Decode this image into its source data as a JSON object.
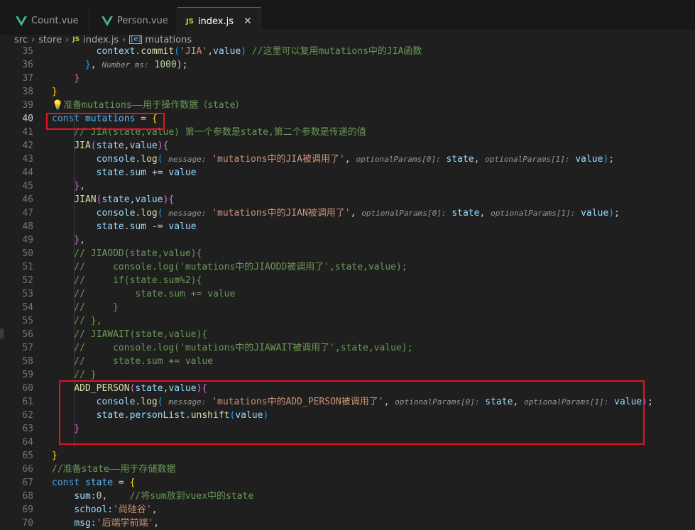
{
  "tabs": [
    {
      "label": "Count.vue",
      "icon": "vue-icon",
      "active": false
    },
    {
      "label": "Person.vue",
      "icon": "vue-icon",
      "active": false
    },
    {
      "label": "index.js",
      "icon": "js-icon",
      "active": true
    }
  ],
  "tab_icons": {
    "js": "JS",
    "close": "✕"
  },
  "breadcrumb": {
    "parts": [
      "src",
      "store",
      "index.js",
      "mutations"
    ],
    "separator": "›",
    "js_badge": "JS",
    "symbol_badge": "[e]"
  },
  "colors": {
    "accent": "#0078d4",
    "highlight_box": "#e81123",
    "keyword": "#569cd6",
    "string": "#ce9178",
    "comment": "#6a9955",
    "function": "#dcdcaa",
    "variable": "#9cdcfe",
    "number": "#b5cea8",
    "bracket_gold": "#ffd700",
    "bracket_purple": "#da70d6",
    "bracket_blue": "#179fff"
  },
  "lines": [
    {
      "n": "35",
      "segs": [
        [
          "        ",
          "#cccccc"
        ],
        [
          "context",
          "#9cdcfe"
        ],
        [
          ".",
          "#cccccc"
        ],
        [
          "commit",
          "#dcdcaa"
        ],
        [
          "(",
          "#179fff"
        ],
        [
          "'JIA'",
          "#ce9178"
        ],
        [
          ",",
          "#cccccc"
        ],
        [
          "value",
          "#9cdcfe"
        ],
        [
          ")",
          "#179fff"
        ],
        [
          " //这里可以复用mutations中的JIA函数",
          "#6a9955"
        ]
      ]
    },
    {
      "n": "36",
      "segs": [
        [
          "      ",
          "#cccccc"
        ],
        [
          "}",
          "#179fff"
        ],
        [
          ", ",
          "#cccccc"
        ],
        [
          "Number ms:",
          "hint"
        ],
        [
          " ",
          "#cccccc"
        ],
        [
          "1000",
          "#b5cea8"
        ],
        [
          ");",
          "#cccccc"
        ]
      ]
    },
    {
      "n": "37",
      "segs": [
        [
          "    ",
          "#cccccc"
        ],
        [
          "}",
          "#da70d6"
        ]
      ]
    },
    {
      "n": "38",
      "segs": [
        [
          "}",
          "#ffd700"
        ]
      ]
    },
    {
      "n": "39",
      "segs": [
        [
          "💡",
          "bulb"
        ],
        [
          "准备mutations——用于操作数据（state）",
          "#6a9955"
        ]
      ]
    },
    {
      "n": "40",
      "segs": [
        [
          "const",
          "#569cd6"
        ],
        [
          " ",
          "#cccccc"
        ],
        [
          "mutations",
          "#4fc1ff"
        ],
        [
          " = ",
          "#cccccc"
        ],
        [
          "{",
          "#ffd700"
        ]
      ],
      "current": true
    },
    {
      "n": "41",
      "segs": [
        [
          "    // JIA(state,value) 第一个参数是state,第二个参数是传递的值",
          "#6a9955"
        ]
      ]
    },
    {
      "n": "42",
      "segs": [
        [
          "    ",
          "#cccccc"
        ],
        [
          "JIA",
          "#dcdcaa"
        ],
        [
          "(",
          "#da70d6"
        ],
        [
          "state",
          "#9cdcfe"
        ],
        [
          ",",
          "#cccccc"
        ],
        [
          "value",
          "#9cdcfe"
        ],
        [
          ")",
          "#da70d6"
        ],
        [
          "{",
          "#da70d6"
        ]
      ]
    },
    {
      "n": "43",
      "segs": [
        [
          "        ",
          "#cccccc"
        ],
        [
          "console",
          "#9cdcfe"
        ],
        [
          ".",
          "#cccccc"
        ],
        [
          "log",
          "#dcdcaa"
        ],
        [
          "( ",
          "#179fff"
        ],
        [
          "message:",
          "hint"
        ],
        [
          " ",
          "#cccccc"
        ],
        [
          "'mutations中的JIA被调用了'",
          "#ce9178"
        ],
        [
          ", ",
          "#cccccc"
        ],
        [
          "optionalParams[0]:",
          "hint"
        ],
        [
          " ",
          "#cccccc"
        ],
        [
          "state",
          "#9cdcfe"
        ],
        [
          ", ",
          "#cccccc"
        ],
        [
          "optionalParams[1]:",
          "hint"
        ],
        [
          " ",
          "#cccccc"
        ],
        [
          "value",
          "#9cdcfe"
        ],
        [
          ")",
          "#179fff"
        ],
        [
          ";",
          "#cccccc"
        ]
      ]
    },
    {
      "n": "44",
      "segs": [
        [
          "        ",
          "#cccccc"
        ],
        [
          "state",
          "#9cdcfe"
        ],
        [
          ".",
          "#cccccc"
        ],
        [
          "sum",
          "#9cdcfe"
        ],
        [
          " += ",
          "#cccccc"
        ],
        [
          "value",
          "#9cdcfe"
        ]
      ]
    },
    {
      "n": "45",
      "segs": [
        [
          "    ",
          "#cccccc"
        ],
        [
          "}",
          "#da70d6"
        ],
        [
          ",",
          "#cccccc"
        ]
      ]
    },
    {
      "n": "46",
      "segs": [
        [
          "    ",
          "#cccccc"
        ],
        [
          "JIAN",
          "#dcdcaa"
        ],
        [
          "(",
          "#da70d6"
        ],
        [
          "state",
          "#9cdcfe"
        ],
        [
          ",",
          "#cccccc"
        ],
        [
          "value",
          "#9cdcfe"
        ],
        [
          ")",
          "#da70d6"
        ],
        [
          "{",
          "#da70d6"
        ]
      ]
    },
    {
      "n": "47",
      "segs": [
        [
          "        ",
          "#cccccc"
        ],
        [
          "console",
          "#9cdcfe"
        ],
        [
          ".",
          "#cccccc"
        ],
        [
          "log",
          "#dcdcaa"
        ],
        [
          "( ",
          "#179fff"
        ],
        [
          "message:",
          "hint"
        ],
        [
          " ",
          "#cccccc"
        ],
        [
          "'mutations中的JIAN被调用了'",
          "#ce9178"
        ],
        [
          ", ",
          "#cccccc"
        ],
        [
          "optionalParams[0]:",
          "hint"
        ],
        [
          " ",
          "#cccccc"
        ],
        [
          "state",
          "#9cdcfe"
        ],
        [
          ", ",
          "#cccccc"
        ],
        [
          "optionalParams[1]:",
          "hint"
        ],
        [
          " ",
          "#cccccc"
        ],
        [
          "value",
          "#9cdcfe"
        ],
        [
          ")",
          "#179fff"
        ],
        [
          ";",
          "#cccccc"
        ]
      ]
    },
    {
      "n": "48",
      "segs": [
        [
          "        ",
          "#cccccc"
        ],
        [
          "state",
          "#9cdcfe"
        ],
        [
          ".",
          "#cccccc"
        ],
        [
          "sum",
          "#9cdcfe"
        ],
        [
          " -= ",
          "#cccccc"
        ],
        [
          "value",
          "#9cdcfe"
        ]
      ]
    },
    {
      "n": "49",
      "segs": [
        [
          "    ",
          "#cccccc"
        ],
        [
          "}",
          "#da70d6"
        ],
        [
          ",",
          "#cccccc"
        ]
      ]
    },
    {
      "n": "50",
      "segs": [
        [
          "    // JIAODD(state,value){",
          "#6a9955"
        ]
      ]
    },
    {
      "n": "51",
      "segs": [
        [
          "    //     console.log('mutations中的JIAODD被调用了',state,value);",
          "#6a9955"
        ]
      ]
    },
    {
      "n": "52",
      "segs": [
        [
          "    //     if(state.sum%2){",
          "#6a9955"
        ]
      ]
    },
    {
      "n": "53",
      "segs": [
        [
          "    //         state.sum += value",
          "#6a9955"
        ]
      ]
    },
    {
      "n": "54",
      "segs": [
        [
          "    //     }",
          "#6a9955"
        ]
      ]
    },
    {
      "n": "55",
      "segs": [
        [
          "    // },",
          "#6a9955"
        ]
      ]
    },
    {
      "n": "56",
      "segs": [
        [
          "    // JIAWAIT(state,value){",
          "#6a9955"
        ]
      ]
    },
    {
      "n": "57",
      "segs": [
        [
          "    //     console.log('mutations中的JIAWAIT被调用了',state,value);",
          "#6a9955"
        ]
      ]
    },
    {
      "n": "58",
      "segs": [
        [
          "    //     state.sum += value",
          "#6a9955"
        ]
      ]
    },
    {
      "n": "59",
      "segs": [
        [
          "    // }",
          "#6a9955"
        ]
      ]
    },
    {
      "n": "60",
      "segs": [
        [
          "    ",
          "#cccccc"
        ],
        [
          "ADD_PERSON",
          "#dcdcaa"
        ],
        [
          "(",
          "#da70d6"
        ],
        [
          "state",
          "#9cdcfe"
        ],
        [
          ",",
          "#cccccc"
        ],
        [
          "value",
          "#9cdcfe"
        ],
        [
          ")",
          "#da70d6"
        ],
        [
          "{",
          "#da70d6"
        ]
      ]
    },
    {
      "n": "61",
      "segs": [
        [
          "        ",
          "#cccccc"
        ],
        [
          "console",
          "#9cdcfe"
        ],
        [
          ".",
          "#cccccc"
        ],
        [
          "log",
          "#dcdcaa"
        ],
        [
          "( ",
          "#179fff"
        ],
        [
          "message:",
          "hint"
        ],
        [
          " ",
          "#cccccc"
        ],
        [
          "'mutations中的ADD_PERSON被调用了'",
          "#ce9178"
        ],
        [
          ", ",
          "#cccccc"
        ],
        [
          "optionalParams[0]:",
          "hint"
        ],
        [
          " ",
          "#cccccc"
        ],
        [
          "state",
          "#9cdcfe"
        ],
        [
          ", ",
          "#cccccc"
        ],
        [
          "optionalParams[1]:",
          "hint"
        ],
        [
          " ",
          "#cccccc"
        ],
        [
          "value",
          "#9cdcfe"
        ],
        [
          ")",
          "#179fff"
        ],
        [
          ";",
          "#cccccc"
        ]
      ]
    },
    {
      "n": "62",
      "segs": [
        [
          "        ",
          "#cccccc"
        ],
        [
          "state",
          "#9cdcfe"
        ],
        [
          ".",
          "#cccccc"
        ],
        [
          "personList",
          "#9cdcfe"
        ],
        [
          ".",
          "#cccccc"
        ],
        [
          "unshift",
          "#dcdcaa"
        ],
        [
          "(",
          "#179fff"
        ],
        [
          "value",
          "#9cdcfe"
        ],
        [
          ")",
          "#179fff"
        ]
      ]
    },
    {
      "n": "63",
      "segs": [
        [
          "    ",
          "#cccccc"
        ],
        [
          "}",
          "#da70d6"
        ]
      ]
    },
    {
      "n": "64",
      "segs": []
    },
    {
      "n": "65",
      "segs": [
        [
          "}",
          "#ffd700"
        ]
      ]
    },
    {
      "n": "66",
      "segs": [
        [
          "//准备state——用于存储数据",
          "#6a9955"
        ]
      ]
    },
    {
      "n": "67",
      "segs": [
        [
          "const",
          "#569cd6"
        ],
        [
          " ",
          "#cccccc"
        ],
        [
          "state",
          "#4fc1ff"
        ],
        [
          " = ",
          "#cccccc"
        ],
        [
          "{",
          "#ffd700"
        ]
      ]
    },
    {
      "n": "68",
      "segs": [
        [
          "    ",
          "#cccccc"
        ],
        [
          "sum",
          "#9cdcfe"
        ],
        [
          ":",
          "#cccccc"
        ],
        [
          "0",
          "#b5cea8"
        ],
        [
          ",    ",
          "#cccccc"
        ],
        [
          "//将sum放到vuex中的state",
          "#6a9955"
        ]
      ]
    },
    {
      "n": "69",
      "segs": [
        [
          "    ",
          "#cccccc"
        ],
        [
          "school",
          "#9cdcfe"
        ],
        [
          ":",
          "#cccccc"
        ],
        [
          "'尚硅谷'",
          "#ce9178"
        ],
        [
          ",",
          "#cccccc"
        ]
      ]
    },
    {
      "n": "70",
      "segs": [
        [
          "    ",
          "#cccccc"
        ],
        [
          "msg",
          "#9cdcfe"
        ],
        [
          ":",
          "#cccccc"
        ],
        [
          "'后端学前端'",
          "#ce9178"
        ],
        [
          ",",
          "#cccccc"
        ]
      ]
    }
  ]
}
